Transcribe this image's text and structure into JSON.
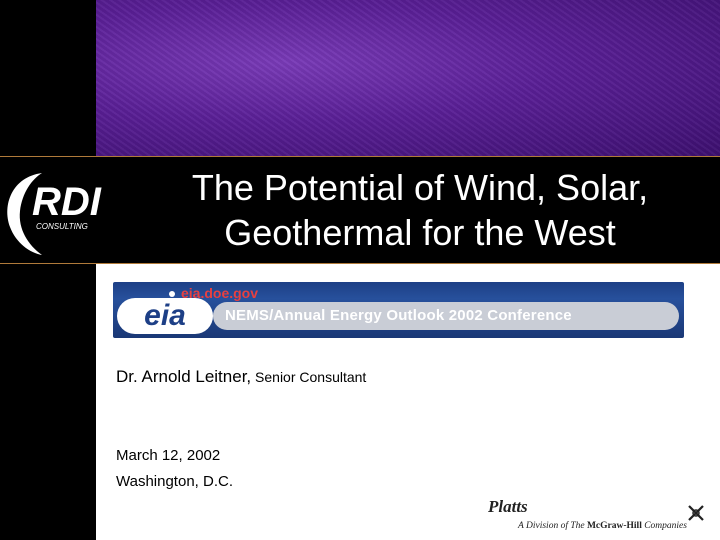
{
  "slide": {
    "title_line1": "The Potential of Wind, Solar,",
    "title_line2": "Geothermal for the West",
    "presenter_name": "Dr. Arnold Leitner,",
    "presenter_role": " Senior Consultant",
    "date": "March 12, 2002",
    "location": "Washington, D.C."
  },
  "logo": {
    "name": "RDI",
    "sub": "CONSULTING"
  },
  "eia_banner": {
    "url": "eia.doe.gov",
    "logo_text": "eia",
    "conference": "NEMS/Annual Energy Outlook 2002 Conference"
  },
  "footer": {
    "brand": "Platts",
    "division_prefix": "A Division of ",
    "company_the": "The ",
    "company_name": "McGraw-Hill",
    "company_suffix": " Companies"
  },
  "colors": {
    "banner_purple": "#5a1f96",
    "eia_blue": "#1d3f86",
    "url_red": "#e84040"
  }
}
